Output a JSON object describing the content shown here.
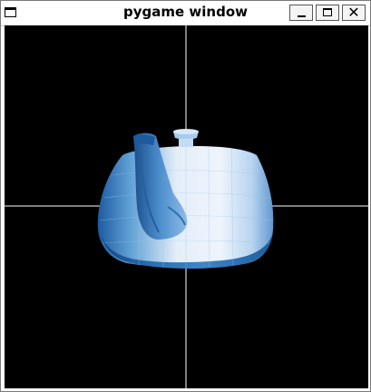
{
  "window": {
    "title": "pygame window",
    "controls": {
      "minimize": "minimize-icon",
      "maximize": "maximize-icon",
      "close": "close-icon"
    }
  },
  "viewport": {
    "background": "#000000",
    "crosshair_color": "#ffffff",
    "object": "teapot"
  }
}
